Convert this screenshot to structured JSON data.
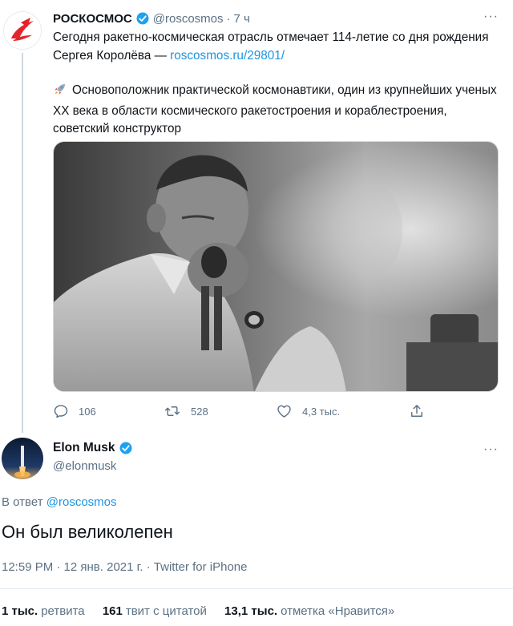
{
  "tweet1": {
    "name": "РОСКОСМОС",
    "handle": "@roscosmos",
    "dot": "·",
    "time": "7 ч",
    "text_line1_pre": "Сегодня ракетно-космическая отрасль отмечает 114-летие со дня рождения Сергея Королёва — ",
    "link": "roscosmos.ru/29801/",
    "text_para2": "Основоположник практической космонавтики, один из крупнейших ученых XX века в области космического ракетостроения и кораблестроения, советский конструктор",
    "replies": "106",
    "retweets": "528",
    "likes": "4,3 тыс."
  },
  "tweet2": {
    "name": "Elon Musk",
    "handle": "@elonmusk",
    "reply_prefix": "В ответ",
    "reply_handle": "@roscosmos",
    "text": "Он был великолепен",
    "meta": "12:59 PM · 12 янв. 2021 г. · Twitter for iPhone",
    "stats": [
      {
        "num": "1 тыс.",
        "label": "ретвита"
      },
      {
        "num": "161",
        "label": "твит с цитатой"
      },
      {
        "num": "13,1 тыс.",
        "label": "отметка «Нравится»"
      }
    ]
  },
  "icons": {
    "more": "···"
  },
  "colors": {
    "accent": "#1b95e0",
    "verified": "#1da1f2",
    "muted": "#5b7083",
    "roscosmos_red": "#e4242b"
  }
}
